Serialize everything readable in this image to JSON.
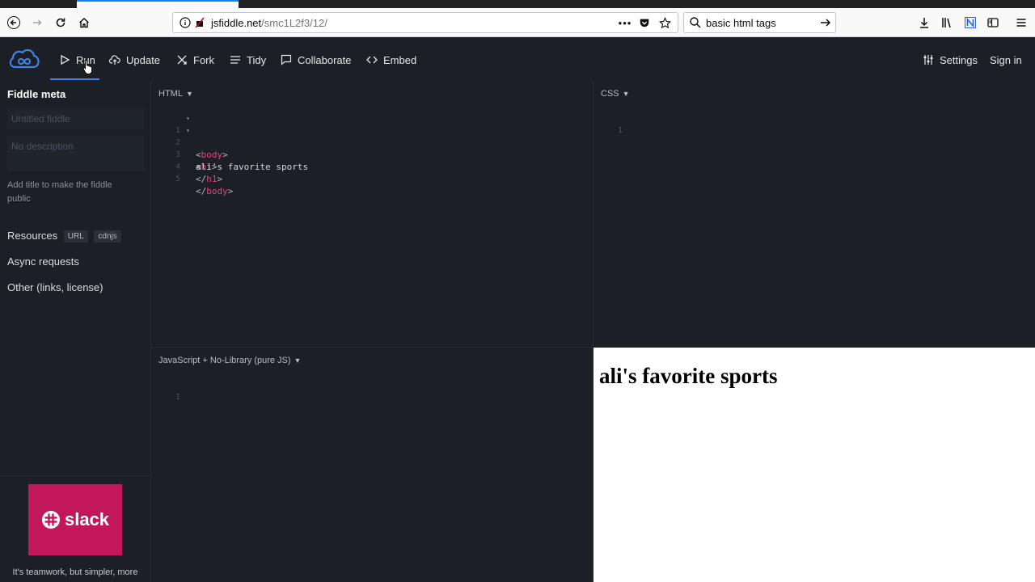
{
  "browser": {
    "url_host": "jsfiddle.net",
    "url_path": "/smc1L2f3/12/",
    "search_text": "basic html tags",
    "url_menu_label": "•••"
  },
  "header": {
    "actions": [
      {
        "label": "Run",
        "icon": "play-icon"
      },
      {
        "label": "Update",
        "icon": "cloud-upload-icon"
      },
      {
        "label": "Fork",
        "icon": "fork-icon"
      },
      {
        "label": "Tidy",
        "icon": "lines-icon"
      },
      {
        "label": "Collaborate",
        "icon": "chat-icon"
      },
      {
        "label": "Embed",
        "icon": "code-icon"
      }
    ],
    "settings_label": "Settings",
    "signin_label": "Sign in"
  },
  "sidebar": {
    "title": "Fiddle meta",
    "title_placeholder": "Untitled fiddle",
    "description_placeholder": "No description",
    "hint": "Add title to make the fiddle public",
    "resources_label": "Resources",
    "resource_badges": [
      "URL",
      "cdnjs"
    ],
    "async_label": "Async requests",
    "other_label": "Other (links, license)",
    "ad_brand": "slack",
    "ad_text": "It's teamwork, but simpler, more"
  },
  "panels": {
    "html_label": "HTML",
    "css_label": "CSS",
    "js_label": "JavaScript + No-Library (pure JS)",
    "caret": "▼",
    "html_lines": [
      {
        "num": "1",
        "open": "<",
        "tag": "body",
        "close": ">",
        "fold": "▾"
      },
      {
        "num": "2",
        "open": "<",
        "tag": "h1",
        "close": ">",
        "fold": "▾"
      },
      {
        "num": "3",
        "text": "ali's favorite sports"
      },
      {
        "num": "4",
        "open": "</",
        "tag": "h1",
        "close": ">"
      },
      {
        "num": "5",
        "open": "</",
        "tag": "body",
        "close": ">"
      }
    ],
    "css_line_num": "1",
    "js_line_num": "1"
  },
  "result": {
    "heading": "ali's favorite sports"
  },
  "colors": {
    "background": "#1c1f26",
    "accent": "#3d84e6",
    "tag": "#e0457b",
    "slack": "#c2185b"
  }
}
